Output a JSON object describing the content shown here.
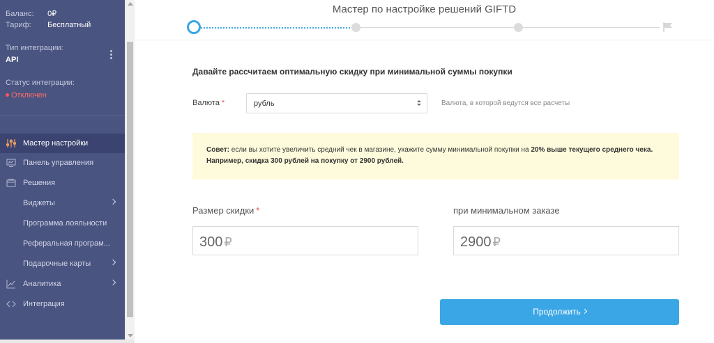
{
  "sidebar": {
    "balance_label": "Баланс:",
    "balance_value": "0₽",
    "tariff_label": "Тариф:",
    "tariff_value": "Бесплатный",
    "integration_type_label": "Тип интеграции:",
    "integration_type_value": "API",
    "integration_status_label": "Статус интеграции:",
    "integration_status_value": "Отключен",
    "nav": [
      {
        "label": "Мастер настройки",
        "icon": "sliders-icon",
        "active": true
      },
      {
        "label": "Панель управления",
        "icon": "dashboard-icon"
      },
      {
        "label": "Решения",
        "icon": "solutions-icon"
      },
      {
        "label": "Виджеты",
        "sub": true,
        "chevron": true
      },
      {
        "label": "Программа лояльности",
        "sub": true
      },
      {
        "label": "Реферальная програм...",
        "sub": true
      },
      {
        "label": "Подарочные карты",
        "sub": true,
        "chevron": true
      },
      {
        "label": "Аналитика",
        "icon": "analytics-icon",
        "chevron": true
      },
      {
        "label": "Интеграция",
        "icon": "code-icon"
      }
    ]
  },
  "header": {
    "title": "Мастер по настройке решений GIFTD"
  },
  "main": {
    "heading": "Давайте рассчитаем оптимальную скидку при минимальной суммы покупки",
    "currency_label": "Валюта",
    "required_mark": "*",
    "currency_value": "рубль",
    "currency_hint": "Валюта, в которой ведутся все расчеты",
    "tip_prefix": "Совет:",
    "tip_text_1": " если вы хотите увеличить средний чек в магазине, укажите сумму минимальной покупки на ",
    "tip_bold_1": "20% выше текущего среднего чека.",
    "tip_bold_2": " Например, скидка 300 рублей на покупку от 2900 рублей.",
    "discount_label": "Размер скидки",
    "discount_value": "300",
    "min_order_label": "при минимальном заказе",
    "min_order_value": "2900",
    "currency_symbol": "₽",
    "continue_label": "Продолжить"
  },
  "colors": {
    "sidebar_bg": "#4a5480",
    "accent": "#3ba6e6",
    "status_off": "#ff6b6b",
    "tip_bg": "#fefbdc"
  }
}
